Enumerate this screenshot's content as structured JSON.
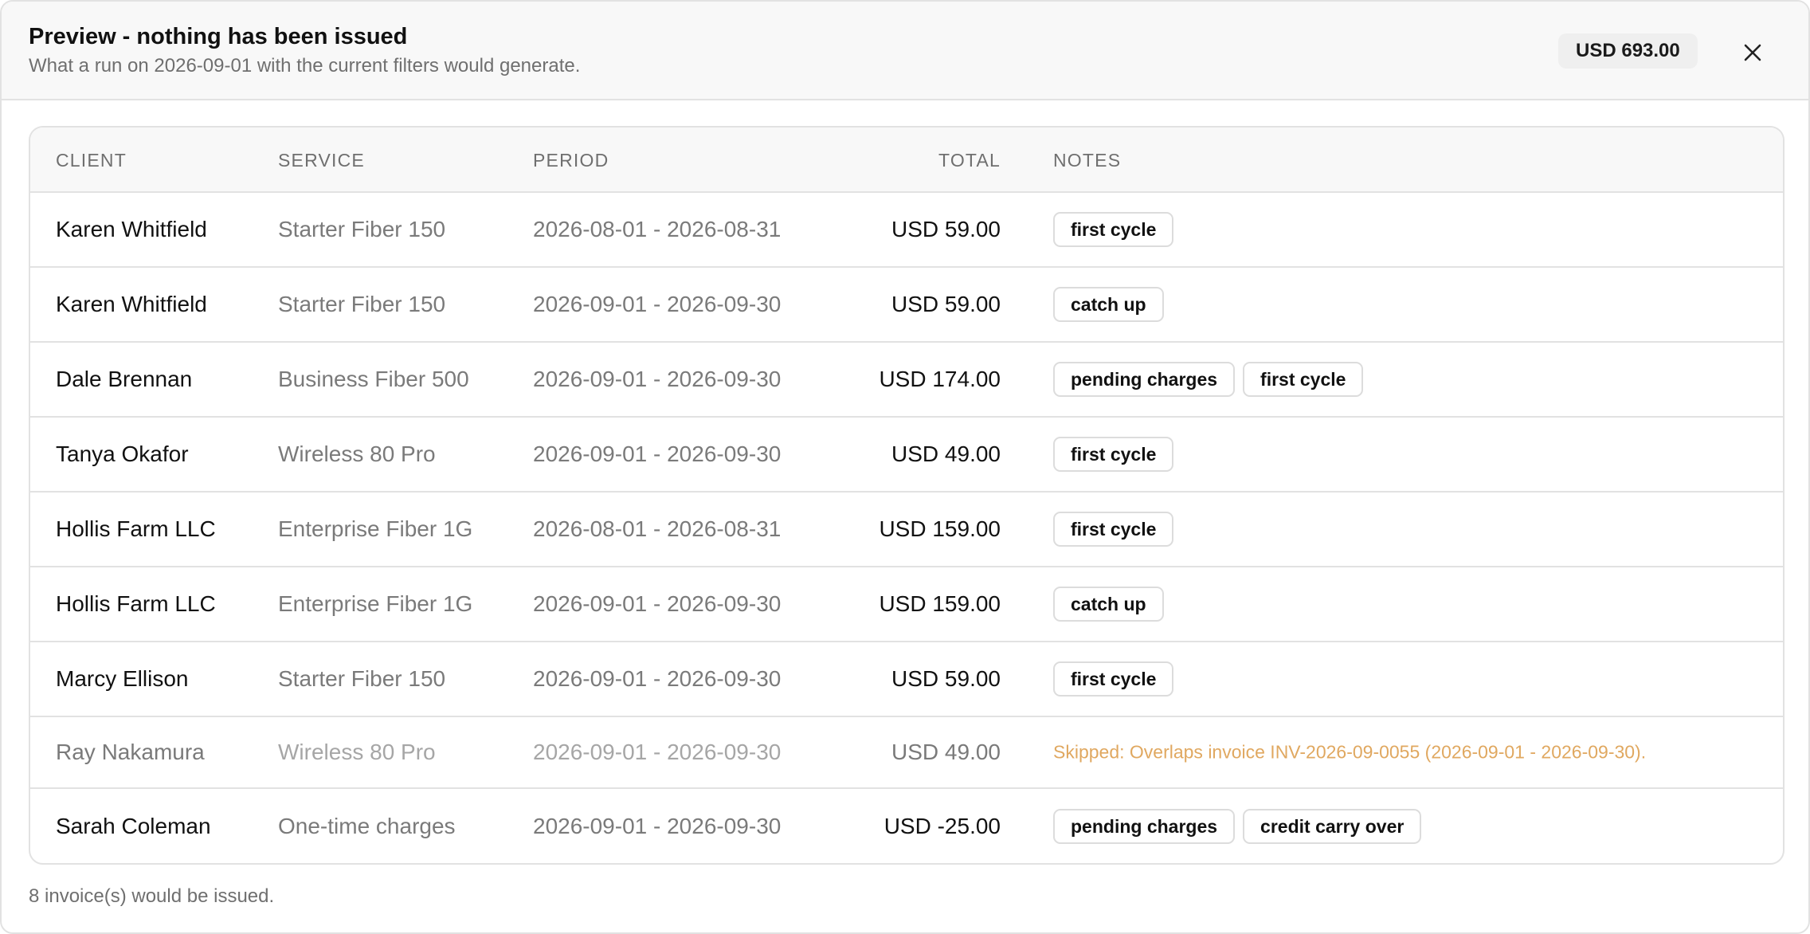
{
  "header": {
    "title": "Preview - nothing has been issued",
    "subtitle": "What a run on 2026-09-01 with the current filters would generate.",
    "total": "USD 693.00",
    "close_icon": "close-icon"
  },
  "table": {
    "columns": {
      "client": "CLIENT",
      "service": "SERVICE",
      "period": "PERIOD",
      "total": "TOTAL",
      "notes": "NOTES"
    },
    "rows": [
      {
        "client": "Karen Whitfield",
        "service": "Starter Fiber 150",
        "period": "2026-08-01 - 2026-08-31",
        "total": "USD 59.00",
        "notes": [
          "first cycle"
        ]
      },
      {
        "client": "Karen Whitfield",
        "service": "Starter Fiber 150",
        "period": "2026-09-01 - 2026-09-30",
        "total": "USD 59.00",
        "notes": [
          "catch up"
        ]
      },
      {
        "client": "Dale Brennan",
        "service": "Business Fiber 500",
        "period": "2026-09-01 - 2026-09-30",
        "total": "USD 174.00",
        "notes": [
          "pending charges",
          "first cycle"
        ]
      },
      {
        "client": "Tanya Okafor",
        "service": "Wireless 80 Pro",
        "period": "2026-09-01 - 2026-09-30",
        "total": "USD 49.00",
        "notes": [
          "first cycle"
        ]
      },
      {
        "client": "Hollis Farm LLC",
        "service": "Enterprise Fiber 1G",
        "period": "2026-08-01 - 2026-08-31",
        "total": "USD 159.00",
        "notes": [
          "first cycle"
        ]
      },
      {
        "client": "Hollis Farm LLC",
        "service": "Enterprise Fiber 1G",
        "period": "2026-09-01 - 2026-09-30",
        "total": "USD 159.00",
        "notes": [
          "catch up"
        ]
      },
      {
        "client": "Marcy Ellison",
        "service": "Starter Fiber 150",
        "period": "2026-09-01 - 2026-09-30",
        "total": "USD 59.00",
        "notes": [
          "first cycle"
        ]
      },
      {
        "client": "Ray Nakamura",
        "service": "Wireless 80 Pro",
        "period": "2026-09-01 - 2026-09-30",
        "total": "USD 49.00",
        "skipped": true,
        "skip_note": "Skipped: Overlaps invoice INV-2026-09-0055 (2026-09-01 - 2026-09-30)."
      },
      {
        "client": "Sarah Coleman",
        "service": "One-time charges",
        "period": "2026-09-01 - 2026-09-30",
        "total": "USD -25.00",
        "notes": [
          "pending charges",
          "credit carry over"
        ]
      }
    ]
  },
  "footer": {
    "summary": "8 invoice(s) would be issued."
  },
  "colors": {
    "skip_note": "#e0a860",
    "header_bg": "#f8f8f8",
    "border": "#e2e2e2"
  }
}
